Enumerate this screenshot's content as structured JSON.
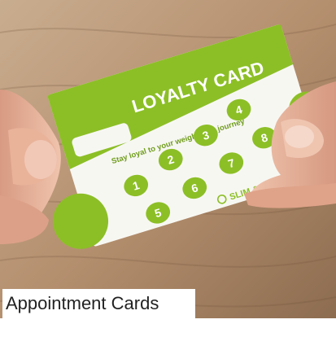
{
  "caption": {
    "text": "Appointment Cards"
  },
  "card": {
    "title": "LOYALTY CARD",
    "tagline": "Stay loyal to your weight loss journey",
    "stamps": [
      "1",
      "2",
      "3",
      "4",
      "5",
      "6",
      "7",
      "8"
    ],
    "brand": "SLIM & FIT",
    "brand_icon": "apple-icon"
  },
  "colors": {
    "card_green": "#8cbf26",
    "card_white": "#f7f7f2",
    "wood_light": "#c8ab8d",
    "wood_dark": "#8c6c50",
    "skin": "#e8b59d"
  }
}
